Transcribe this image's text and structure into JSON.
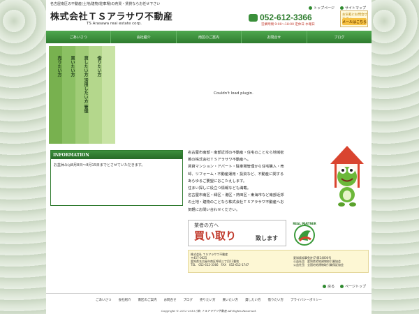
{
  "header": {
    "tagline": "名古屋南区の不動産(土地/建物/駐車場)の売買・賃貸ならお任せ下さい",
    "logo_main": "株式会社ＴＳアラサワ不動産",
    "logo_sub": "TS Arasawa real estate corp.",
    "top_links": [
      "トップページ",
      "サイトマップ"
    ],
    "phone": "052-612-3366",
    "hours": "営業時間 9:00〜18:00 定休日 水曜日",
    "mail_caption": "お気軽にお問合せ下さい",
    "mail_button": "メールはこちら"
  },
  "nav": [
    "ごあいさつ",
    "会社紹介",
    "南区のご案内",
    "お問合せ",
    "ブログ"
  ],
  "vertical_tabs": [
    "売りたい方",
    "買いたい方",
    "貸したい方 活用したい方 管理",
    "借りたい方",
    ""
  ],
  "plugin_text": "Couldn't load plugin.",
  "info": {
    "heading": "INFORMATION",
    "text": "お盆休みは8月8日～8月15日までとさせていただきます。"
  },
  "description": [
    "名古屋市南部・南部近郊の不動産・住宅のことなら地域密",
    "着の株式会社ＴＳアラサワ不動産へ。",
    "賃貸マンション・アパート・駐車場管理から住宅購入・売",
    "却、リフォーム・不動産運用・投資など、不動産に関する",
    "あらゆるご要望におこたえします。",
    "住まい探しに役立つ情報なども満載。",
    "名古屋市南区・緑区・港区・熱田区・東海市など南部近郊",
    "の土地・建物のことなら株式会社ＴＳアラサワ不動産へお",
    "気軽にお問い合わせください。"
  ],
  "kaitori": {
    "top": "業者の方へ",
    "main": "買い取り",
    "tail": "致します"
  },
  "partner_label": "REAL PARTNER",
  "address": {
    "col1": [
      "株式会社 ＴＳアラサワ不動産",
      "〒457-0025",
      "愛知県名古屋市南区呼続三丁目12番地",
      "TEL　052-612-3366　FAX　052-612-1747"
    ],
    "col2": [
      "愛知県知事免許(7)第14000号",
      "公益社団　愛知県宅地建物取引業協会",
      "公益社団　全国宅地建物取引業保証協会"
    ]
  },
  "bottom_links": [
    "戻る",
    "ページトップ"
  ],
  "footer_nav": [
    "ごあいさつ",
    "会社紹介",
    "南区のご案内",
    "お問合せ",
    "ブログ",
    "売りたい方",
    "買いたい方",
    "貸したい方",
    "借りたい方",
    "プライバシーポリシー"
  ],
  "copyright": "Copyright © 2012-2013 (株) ＴＳアラサワ不動産 All Rights Reserved.",
  "colors": {
    "brand_green": "#2e7b2e",
    "phone_green": "#2e7d2e",
    "accent_red": "#c0392b"
  }
}
